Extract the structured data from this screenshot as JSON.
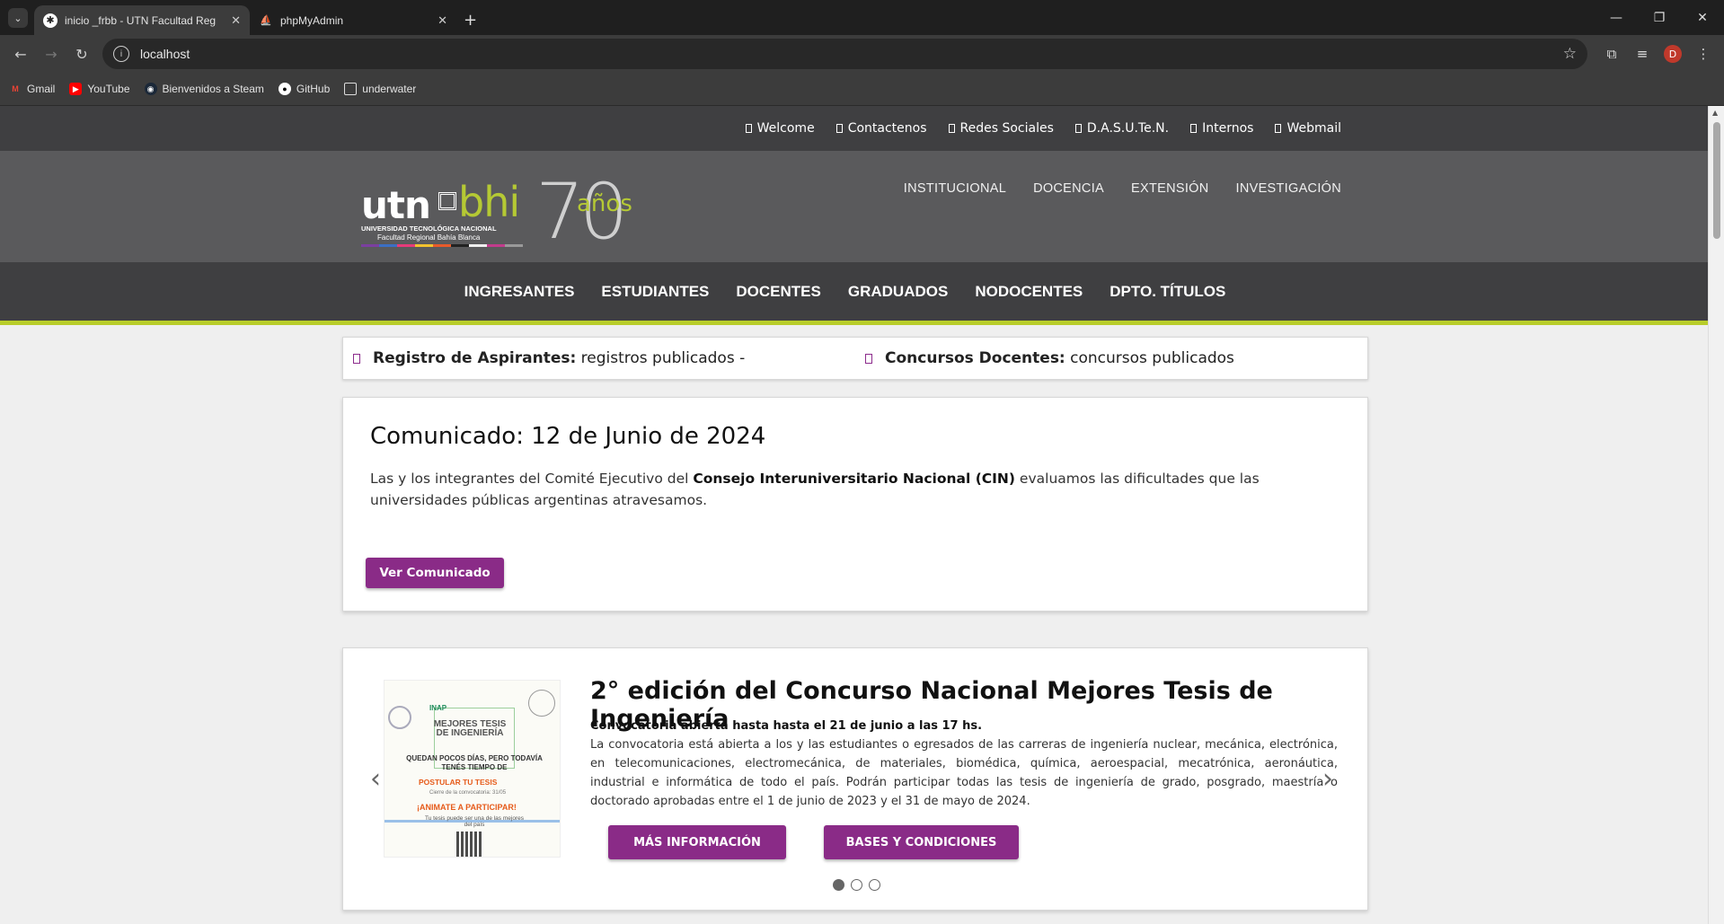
{
  "browser": {
    "tabs": [
      {
        "title": "inicio _frbb - UTN Facultad Reg",
        "active": true
      },
      {
        "title": "phpMyAdmin",
        "active": false
      }
    ],
    "url": "localhost",
    "bookmarks": [
      "Gmail",
      "YouTube",
      "Bienvenidos a Steam",
      "GitHub",
      "underwater"
    ],
    "profile_initial": "D"
  },
  "site": {
    "top_links": [
      "Welcome",
      "Contactenos",
      "Redes Sociales",
      "D.A.S.U.Te.N.",
      "Internos",
      "Webmail"
    ],
    "logo": {
      "utn": "utn",
      "bhi": "bhi",
      "seventy": "70",
      "anios": "años",
      "sub1": "UNIVERSIDAD TECNOLÓGICA NACIONAL",
      "sub2": "Facultad Regional Bahía Blanca"
    },
    "hero_nav": [
      "INSTITUCIONAL",
      "DOCENCIA",
      "EXTENSIÓN",
      "INVESTIGACIÓN"
    ],
    "main_nav": [
      "INGRESANTES",
      "ESTUDIANTES",
      "DOCENTES",
      "GRADUADOS",
      "NODOCENTES",
      "DPTO. TÍTULOS"
    ],
    "accent": "#8a2b87",
    "green": "#b8cd2a"
  },
  "ticker": [
    {
      "label": "Registro de Aspirantes:",
      "text": "registros publicados -"
    },
    {
      "label": "Concursos Docentes:",
      "text": "concursos publicados"
    }
  ],
  "comunicado": {
    "title": "Comunicado: 12 de Junio de 2024",
    "text_before": "Las y los integrantes del Comité Ejecutivo del ",
    "text_bold": "Consejo Interuniversitario Nacional (CIN)",
    "text_after": " evaluamos las dificultades que las universidades públicas argentinas atravesamos.",
    "button": "Ver Comunicado"
  },
  "slide": {
    "title": "2° edición del Concurso Nacional Mejores Tesis de Ingeniería",
    "subtitle": "Convocatoria abierta hasta hasta el 21 de junio a las 17 hs.",
    "body": "La convocatoria está abierta a los y las estudiantes o egresados de las carreras de ingeniería nuclear, mecánica, electrónica, en telecomunicaciones, electromecánica, de materiales, biomédica, química, aeroespacial, mecatrónica, aeronáutica, industrial e informática de todo el país. Podrán participar todas las tesis de ingeniería de grado, posgrado, maestría o doctorado aprobadas entre el 1 de junio de 2023 y el 31 de mayo de 2024.",
    "btn_more": "MÁS INFORMACIÓN",
    "btn_bases": "BASES Y CONDICIONES",
    "poster": {
      "brand": "INAP",
      "t2": "MEJORES TESIS DE INGENIERÍA",
      "t3": "QUEDAN POCOS DÍAS, PERO TODAVÍA TENÉS TIEMPO DE",
      "t4": "POSTULAR TU TESIS",
      "t5": "Cierre de la convocatoria: 31/05",
      "t6": "¡ANIMATE A PARTICIPAR!",
      "t7": "Tu tesis puede ser una de las mejores del país"
    },
    "slides_count": 3,
    "current_slide": 1
  }
}
